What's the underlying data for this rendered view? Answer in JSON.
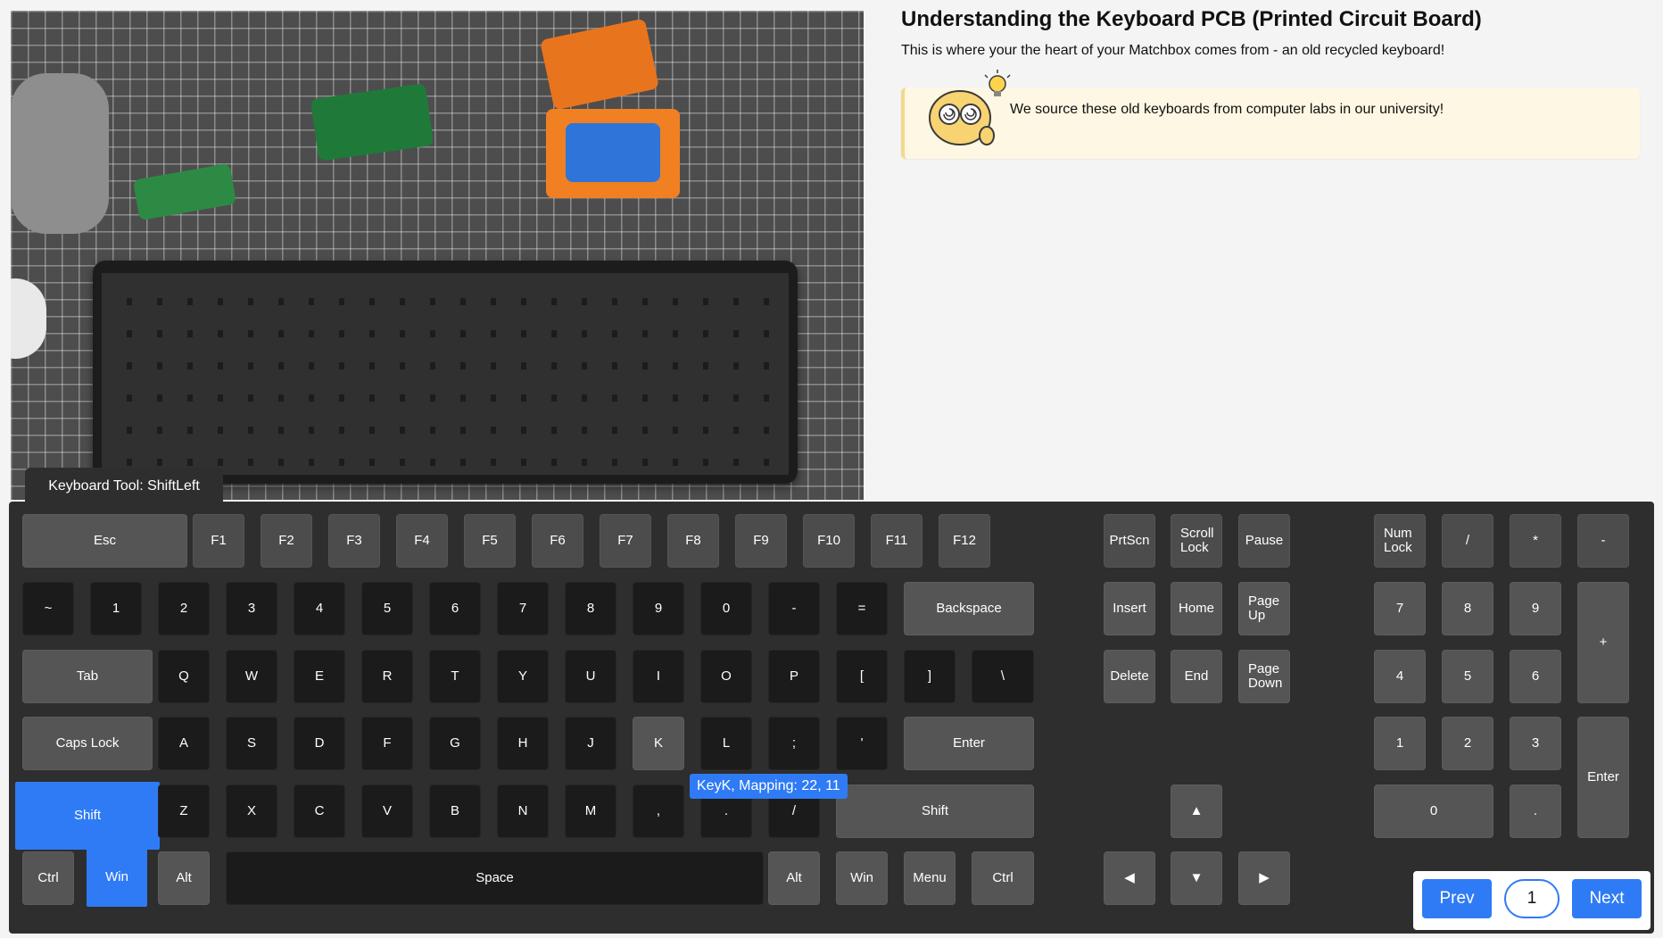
{
  "header": {
    "title": "Understanding the Keyboard PCB (Printed Circuit Board)",
    "subtitle": "This is where your the heart of your Matchbox comes from - an old recycled keyboard!"
  },
  "callout": {
    "text": "We source these old keyboards from computer labs in our university!",
    "icon": "mascot-lightbulb-icon"
  },
  "photo": {
    "icon": "keyboard-photo"
  },
  "tool": {
    "label": "Keyboard Tool: ShiftLeft"
  },
  "tooltip": {
    "text": "KeyK, Mapping: 22, 11"
  },
  "pager": {
    "prev": "Prev",
    "page": "1",
    "next": "Next"
  },
  "colors": {
    "accent": "#2f7bf5",
    "panel": "#2e2e2e",
    "key": "#1b1b1b",
    "key_mod": "#555555"
  },
  "keyboard": {
    "selected_key": "Shift",
    "rows": [
      [
        "Esc",
        "F1",
        "F2",
        "F3",
        "F4",
        "F5",
        "F6",
        "F7",
        "F8",
        "F9",
        "F10",
        "F11",
        "F12",
        "PrtScn",
        "Scroll Lock",
        "Pause",
        "Num Lock",
        "/",
        "*",
        "-"
      ],
      [
        "~",
        "1",
        "2",
        "3",
        "4",
        "5",
        "6",
        "7",
        "8",
        "9",
        "0",
        "-",
        "=",
        "Backspace",
        "Insert",
        "Home",
        "Page Up",
        "7",
        "8",
        "9",
        "+"
      ],
      [
        "Tab",
        "Q",
        "W",
        "E",
        "R",
        "T",
        "Y",
        "U",
        "I",
        "O",
        "P",
        "[",
        "]",
        "\\",
        "Delete",
        "End",
        "Page Down",
        "4",
        "5",
        "6"
      ],
      [
        "Caps Lock",
        "A",
        "S",
        "D",
        "F",
        "G",
        "H",
        "J",
        "K",
        "L",
        ";",
        "'",
        "Enter",
        "1",
        "2",
        "3",
        "Enter"
      ],
      [
        "Shift",
        "Z",
        "X",
        "C",
        "V",
        "B",
        "N",
        "M",
        ",",
        ".",
        "/",
        "Shift",
        "▲",
        "0",
        "."
      ],
      [
        "Ctrl",
        "Win",
        "Alt",
        "Space",
        "Alt",
        "Win",
        "Menu",
        "Ctrl",
        "◀",
        "▼",
        "▶"
      ]
    ]
  }
}
